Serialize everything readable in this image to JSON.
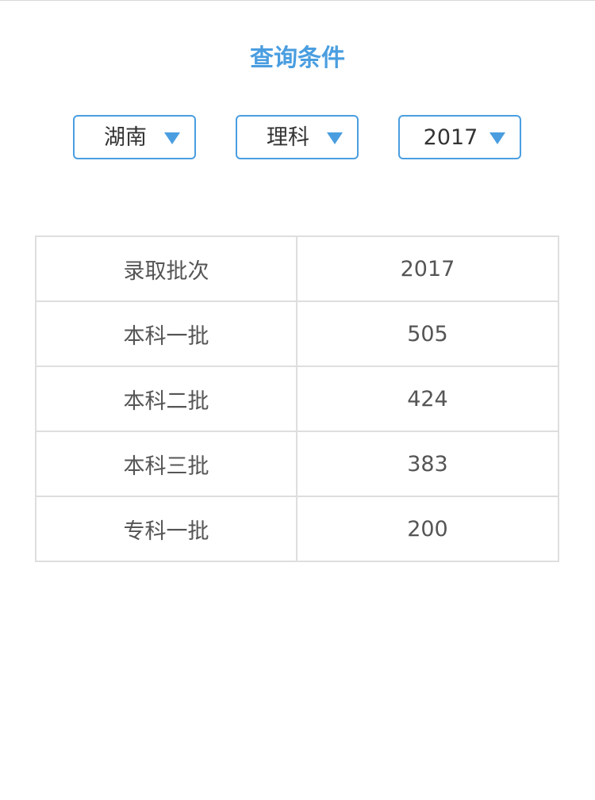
{
  "header": {
    "title": "查询条件"
  },
  "filters": {
    "province": "湖南",
    "subject": "理科",
    "year": "2017"
  },
  "table": {
    "header": [
      "录取批次",
      "2017"
    ],
    "rows": [
      [
        "本科一批",
        "505"
      ],
      [
        "本科二批",
        "424"
      ],
      [
        "本科三批",
        "383"
      ],
      [
        "专科一批",
        "200"
      ]
    ]
  },
  "colors": {
    "accent": "#4a9ee0",
    "text": "#555555",
    "border": "#dedede"
  },
  "icons": {
    "dropdown": "triangle-down"
  }
}
